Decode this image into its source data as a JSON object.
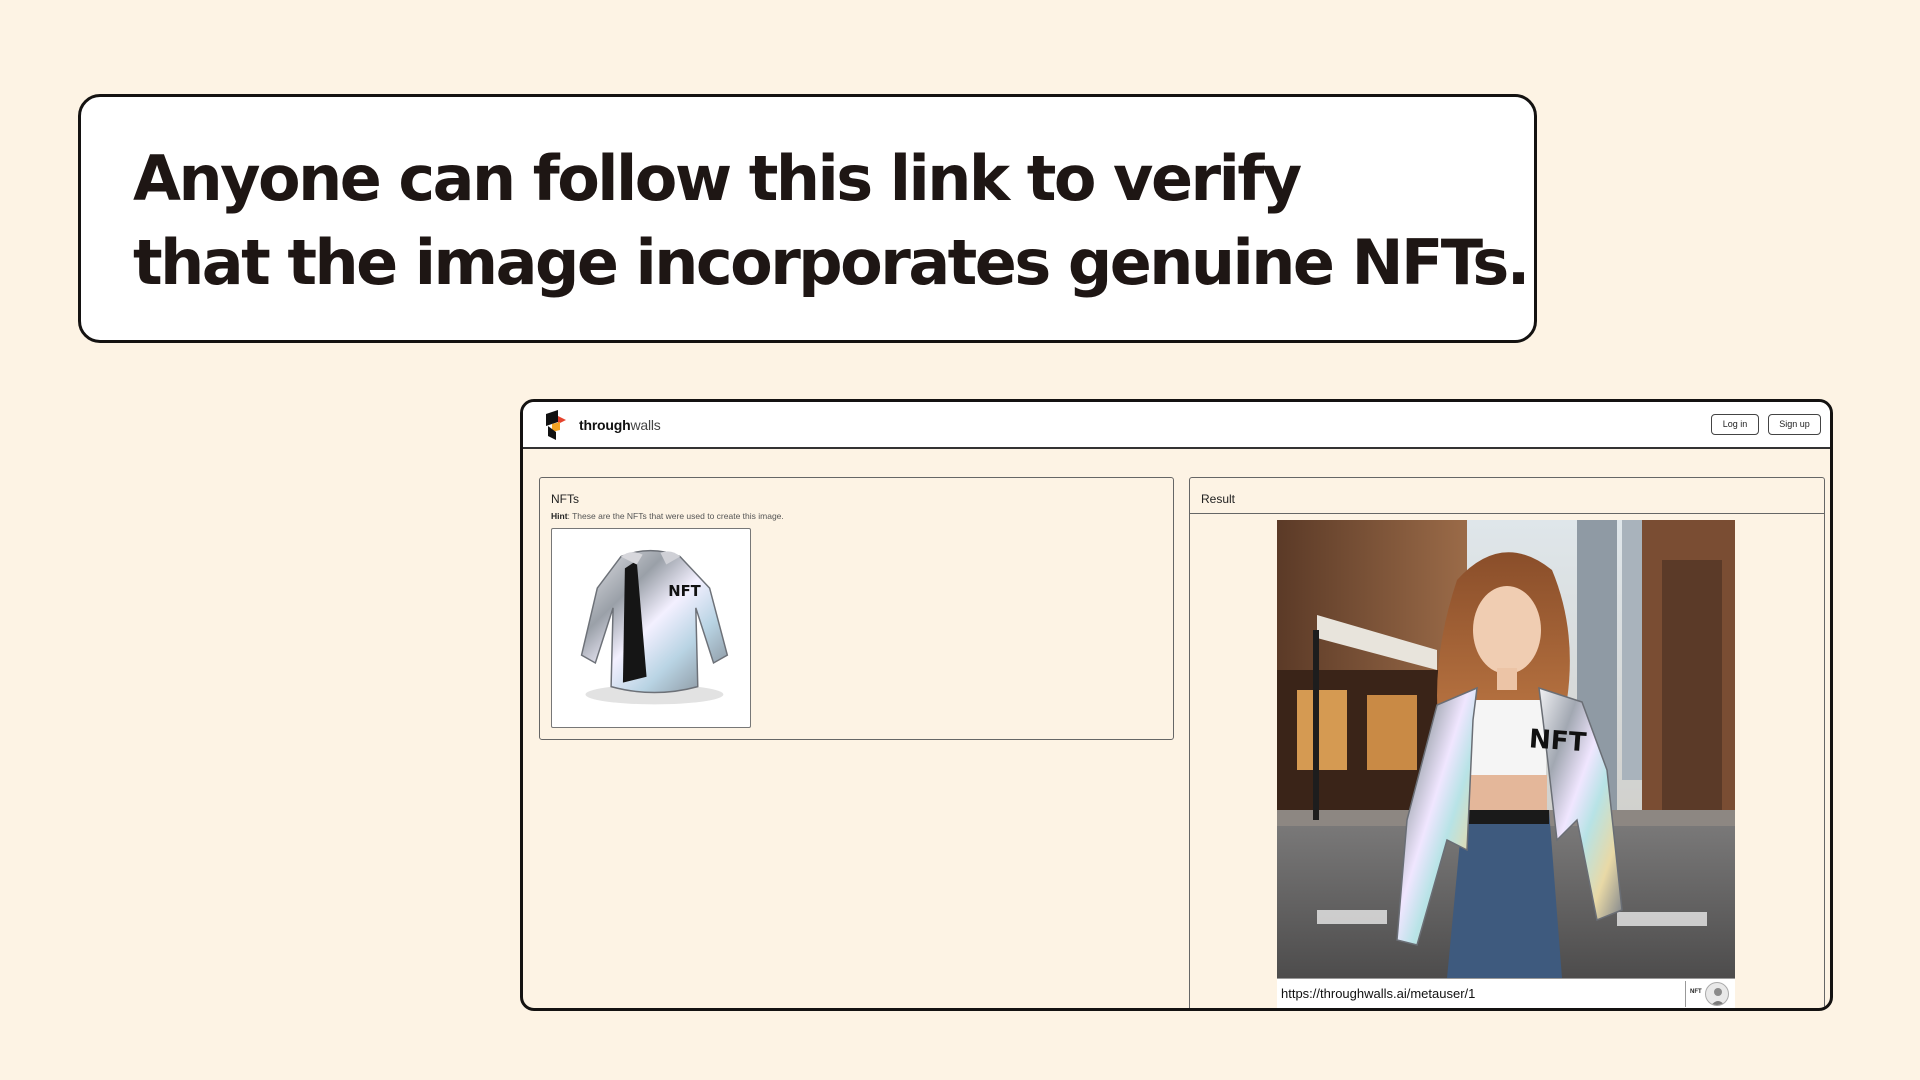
{
  "headline": {
    "line1": "Anyone can follow this link to verify",
    "line2": "that the image incorporates genuine NFTs."
  },
  "app": {
    "brand_bold": "through",
    "brand_regular": "walls",
    "login_label": "Log in",
    "signup_label": "Sign up"
  },
  "nfts_panel": {
    "title": "NFTs",
    "hint_label": "Hint",
    "hint_text": ": These are the NFTs that were used to create this image.",
    "items": [
      {
        "image_text": "NFT"
      }
    ]
  },
  "result_panel": {
    "title": "Result",
    "image_text": "NFT",
    "url": "https://throughwalls.ai/metauser/1",
    "badge_text": "NFT"
  },
  "colors": {
    "background": "#fdf3e4",
    "logo_red": "#e5432d",
    "logo_orange": "#f4a323",
    "logo_black": "#111111"
  }
}
